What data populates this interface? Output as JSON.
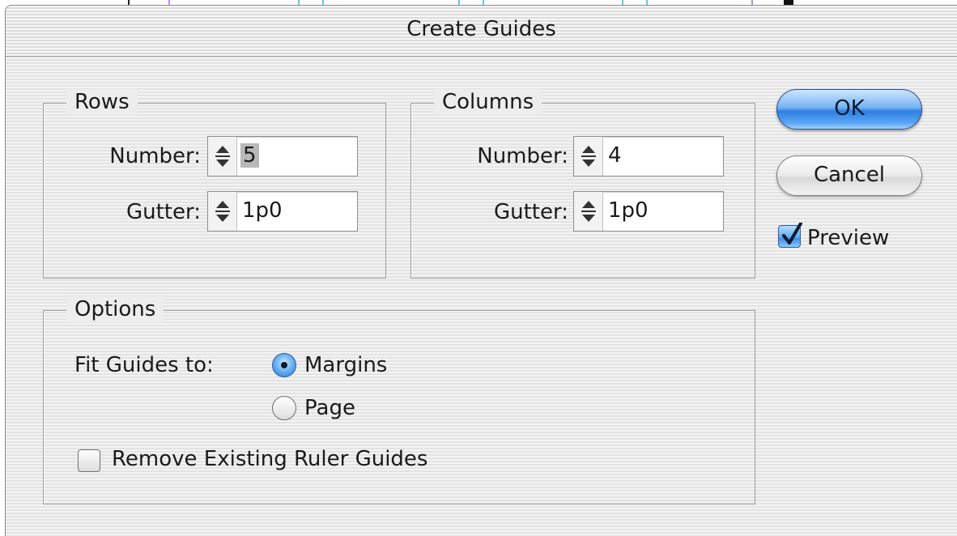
{
  "dialog": {
    "title": "Create Guides"
  },
  "rows": {
    "label": "Rows",
    "number_label": "Number:",
    "number_value": "5",
    "gutter_label": "Gutter:",
    "gutter_value": "1p0"
  },
  "columns": {
    "label": "Columns",
    "number_label": "Number:",
    "number_value": "4",
    "gutter_label": "Gutter:",
    "gutter_value": "1p0"
  },
  "options": {
    "label": "Options",
    "fit_label": "Fit Guides to:",
    "fit_choices": [
      "Margins",
      "Page"
    ],
    "fit_selected": "Margins",
    "remove_label": "Remove Existing Ruler Guides",
    "remove_checked": false
  },
  "buttons": {
    "ok": "OK",
    "cancel": "Cancel"
  },
  "preview": {
    "label": "Preview",
    "checked": true
  },
  "icons": {
    "spinner": "stepper-arrows-icon",
    "check": "checkmark-icon"
  },
  "colors": {
    "ok_button": "#4a94e8",
    "dialog_bg": "#ececec",
    "guide_purple": "#b48cf0",
    "guide_cyan": "#5cc8e8"
  }
}
